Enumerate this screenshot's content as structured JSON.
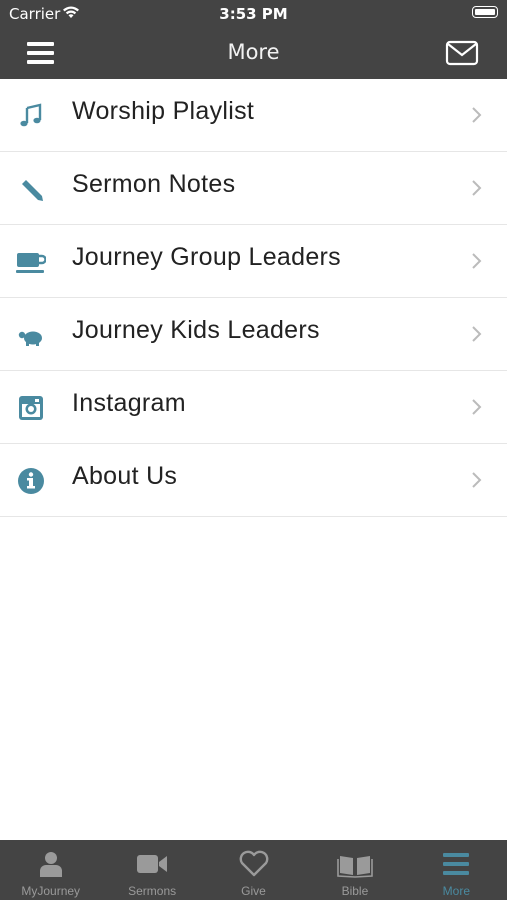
{
  "status_bar": {
    "carrier": "Carrier",
    "time": "3:53 PM"
  },
  "header": {
    "title": "More"
  },
  "menu_items": [
    {
      "label": "Worship Playlist",
      "icon": "music-note-icon"
    },
    {
      "label": "Sermon Notes",
      "icon": "pencil-icon"
    },
    {
      "label": "Journey Group Leaders",
      "icon": "coffee-cup-icon"
    },
    {
      "label": "Journey Kids Leaders",
      "icon": "turtle-icon"
    },
    {
      "label": "Instagram",
      "icon": "instagram-icon"
    },
    {
      "label": "About Us",
      "icon": "info-icon"
    }
  ],
  "tabs": [
    {
      "label": "MyJourney",
      "icon": "person-icon"
    },
    {
      "label": "Sermons",
      "icon": "video-camera-icon"
    },
    {
      "label": "Give",
      "icon": "heart-icon"
    },
    {
      "label": "Bible",
      "icon": "book-icon"
    },
    {
      "label": "More",
      "icon": "menu-icon",
      "active": true
    }
  ],
  "colors": {
    "accent": "#4a8aa0",
    "bar": "#444444",
    "tab_inactive": "#9a9a9a"
  }
}
